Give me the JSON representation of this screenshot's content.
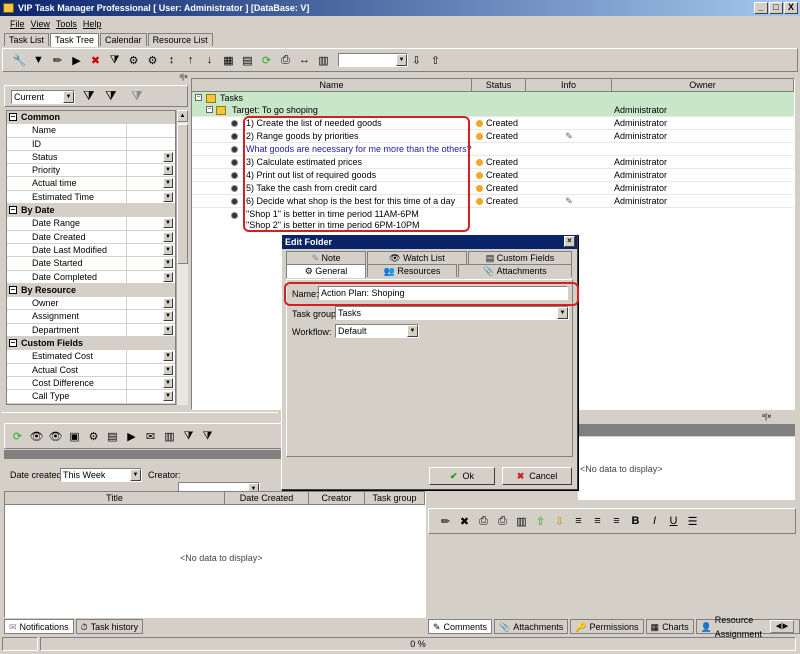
{
  "window": {
    "title": "VIP Task Manager Professional [ User: Administrator ] [DataBase: V]",
    "min": "_",
    "max": "□",
    "close": "X"
  },
  "menu": {
    "file": "File",
    "view": "View",
    "tools": "Tools",
    "help": "Help"
  },
  "main_tabs": [
    "Task List",
    "Task Tree",
    "Calendar",
    "Resource List"
  ],
  "filter": {
    "current": "Current"
  },
  "props": {
    "common": "Common",
    "name": "Name",
    "id": "ID",
    "status": "Status",
    "priority": "Priority",
    "actual_time": "Actual time",
    "estimated_time": "Estimated Time",
    "by_date": "By Date",
    "date_range": "Date Range",
    "date_created": "Date Created",
    "date_last_modified": "Date Last Modified",
    "date_started": "Date Started",
    "date_completed": "Date Completed",
    "by_resource": "By Resource",
    "owner": "Owner",
    "assignment": "Assignment",
    "department": "Department",
    "custom_fields": "Custom Fields",
    "estimated_cost": "Estimated Cost",
    "actual_cost": "Actual Cost",
    "cost_difference": "Cost Difference",
    "call_type": "Call Type"
  },
  "tree": {
    "headers": {
      "name": "Name",
      "status": "Status",
      "info": "Info",
      "owner": "Owner"
    },
    "root": "Tasks",
    "target": "Target: To go shoping",
    "target_owner": "Administrator",
    "rows": [
      {
        "name": "1) Create the list of needed goods",
        "status": "Created",
        "owner": "Administrator"
      },
      {
        "name": "2) Range goods by priorities",
        "status": "Created",
        "owner": "Administrator"
      },
      {
        "name": "What goods are necessary for me more than the others?",
        "status": "",
        "owner": ""
      },
      {
        "name": "3) Calculate estimated prices",
        "status": "Created",
        "owner": "Administrator"
      },
      {
        "name": "4) Print out list of required goods",
        "status": "Created",
        "owner": "Administrator"
      },
      {
        "name": "5) Take the cash from credit card",
        "status": "Created",
        "owner": "Administrator"
      },
      {
        "name": "6) Decide what shop is the best for this time of a day",
        "status": "Created",
        "owner": "Administrator"
      }
    ],
    "note1": "\"Shop 1\" is better in time period 11AM-6PM",
    "note2": "\"Shop 2\" is better in time period  6PM-10PM"
  },
  "dialog": {
    "title": "Edit Folder",
    "tabs_row1": [
      "Note",
      "Watch List",
      "Custom Fields"
    ],
    "tabs_row2": [
      "General",
      "Resources",
      "Attachments"
    ],
    "name_label": "Name:",
    "name_value": "Action Plan: Shoping",
    "task_group_label": "Task group:",
    "task_group_value": "Tasks",
    "workflow_label": "Workflow:",
    "workflow_value": "Default",
    "ok": "Ok",
    "cancel": "Cancel"
  },
  "bottom": {
    "date_created_label": "Date created:",
    "date_created_value": "This Week",
    "creator_label": "Creator:",
    "col_title": "Title",
    "col_date_created": "Date Created",
    "col_creator": "Creator",
    "col_task_group": "Task group",
    "no_data": "<No data to display>",
    "no_data_right": "<No data to display>",
    "left_tabs": [
      "Notifications",
      "Task history"
    ],
    "right_tabs": [
      "Comments",
      "Attachments",
      "Permissions",
      "Charts",
      "Resource Assignment"
    ],
    "progress": "0 %"
  },
  "colors": {
    "title_bar": "#0a246a",
    "highlight_red": "#d42020",
    "target_row": "#c8e6c8",
    "note_blue": "#1a1aa6"
  }
}
